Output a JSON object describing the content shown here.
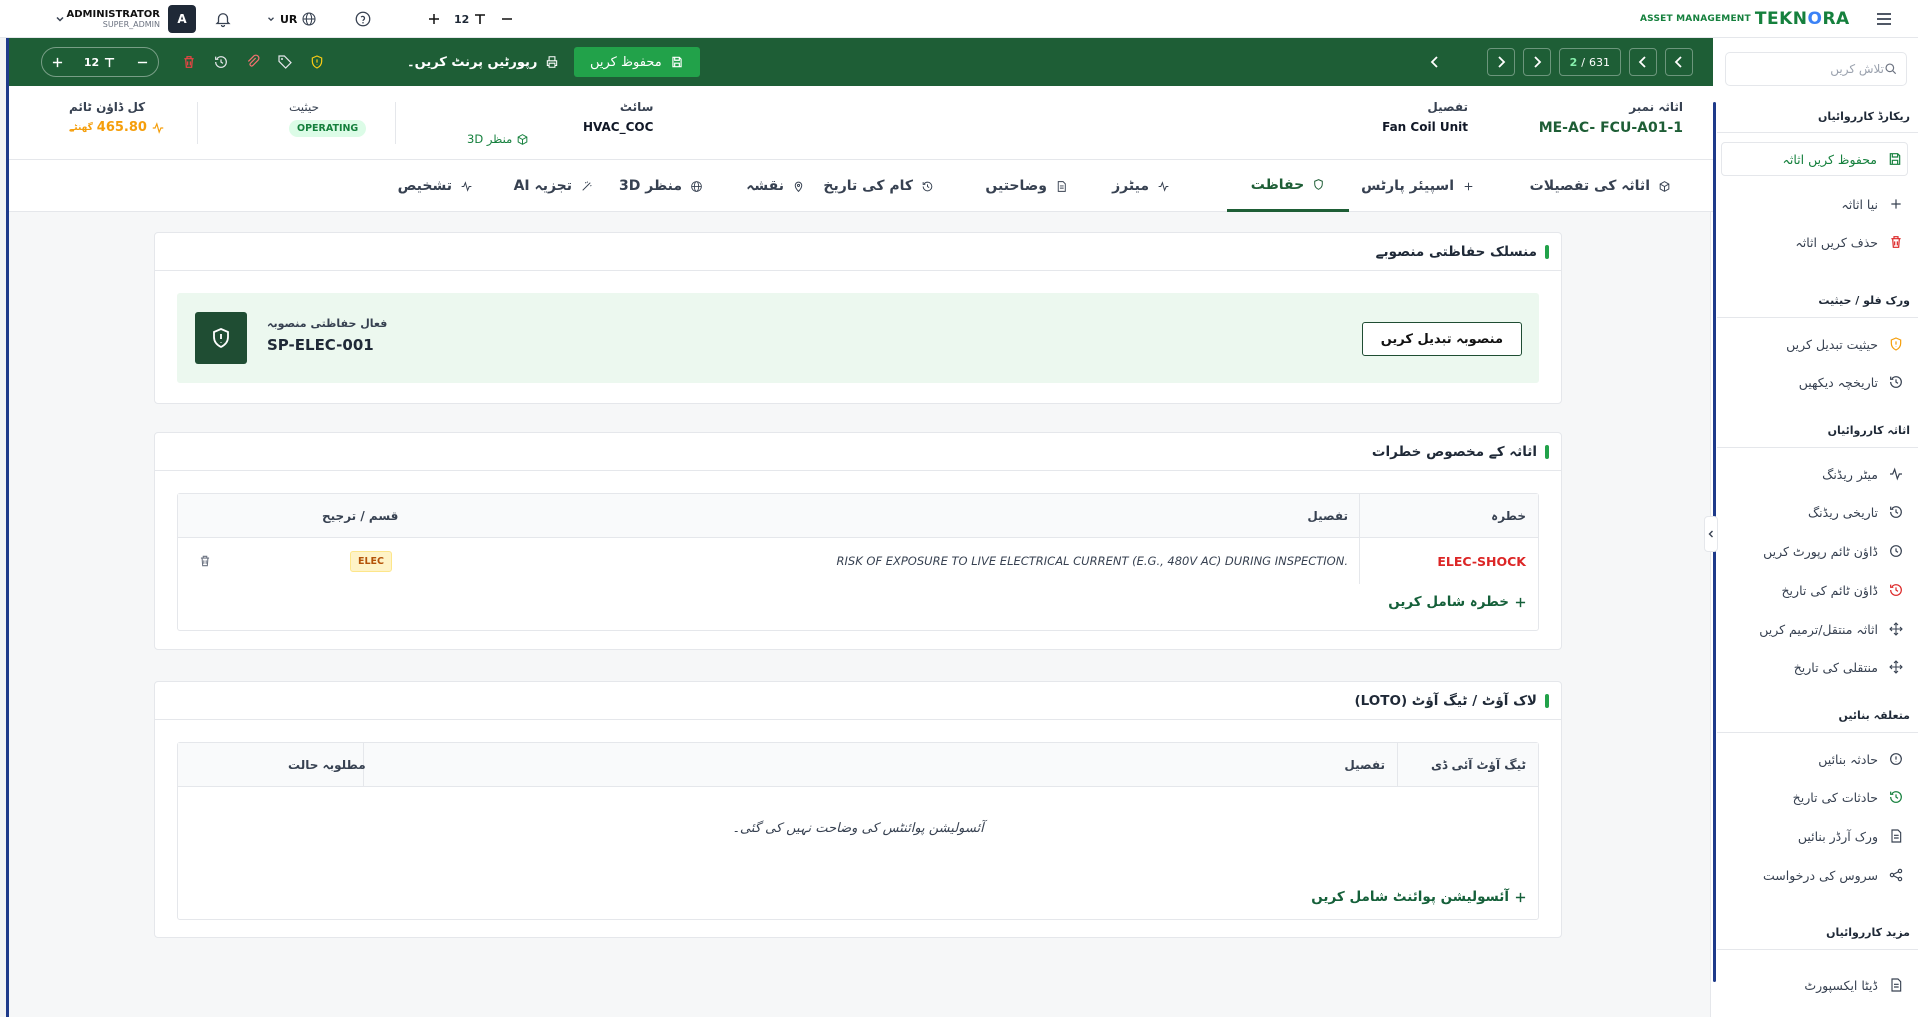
{
  "topbar": {
    "brand_sub": "ASSET MANAGEMENT",
    "brand_logo_a": "TEKN",
    "brand_logo_b": "O",
    "brand_logo_c": "RA",
    "user_name": "ADMINISTRATOR",
    "user_role": "SUPER_ADMIN",
    "avatar": "A",
    "lang": "UR",
    "font_size": "12"
  },
  "sidebar": {
    "search_placeholder": "تلاش کریں",
    "sections": {
      "record": "ریکارڈ کارروائیاں",
      "workflow": "ورک فلو / حیثیت",
      "asset": "اثاثہ کارروائیاں",
      "related": "متعلقہ بنائیں",
      "more": "مزید کارروائیاں"
    },
    "items": {
      "save": "محفوظ کریں اثاثہ",
      "new": "نیا اثاثہ",
      "delete": "حذف کریں اثاثہ",
      "change_status": "حیثیت تبدیل کریں",
      "history": "تاریخچہ دیکھیں",
      "meter_reading": "میٹر ریڈنگ",
      "historical_reading": "تاریخی ریڈنگ",
      "downtime_report": "ڈاؤن ٹائم رپورٹ کریں",
      "downtime_history": "ڈاؤن ٹائم کی تاریخ",
      "move_asset": "اثاثہ منتقل/ترمیم کریں",
      "move_history": "منتقلی کی تاریخ",
      "create_incident": "حادثہ بنائیں",
      "incident_history": "حادثات کی تاریخ",
      "create_work_order": "ورک آرڈر بنائیں",
      "service_request": "سروس کی درخواست",
      "data_export": "ڈیٹا ایکسپورٹ"
    }
  },
  "toolbar": {
    "page_current": "2",
    "page_sep": "/",
    "page_total": "631",
    "save": "محفوظ کریں",
    "print": "رپورٹیں پرنٹ کریں۔",
    "font_size": "12"
  },
  "info": {
    "asset_no_label": "اثاثہ نمبر",
    "asset_no": "ME-AC- FCU-A01-1",
    "desc_label": "تفصیل",
    "desc": "Fan Coil Unit",
    "site_label": "سائٹ",
    "site": "HVAC_COC",
    "view3d": "3D منظر",
    "status_label": "حیثیت",
    "status": "OPERATING",
    "downtime_label": "کل ڈاؤن ٹائم",
    "downtime": "465.80",
    "downtime_unit": "گھنٹے"
  },
  "tabs": {
    "details": "اثاثہ کی تفصیلات",
    "spare_parts": "اسپیئر پارٹس",
    "safety": "حفاظت",
    "meters": "میٹرز",
    "specs": "وضاحتیں",
    "work_history": "کام کی تاریخ",
    "map": "نقشہ",
    "view3d": "3D منظر",
    "ai": "AI تجزیہ",
    "diagnosis": "تشخیص"
  },
  "safety_plan": {
    "title": "منسلک حفاظتی منصوبے",
    "change_btn": "منصوبہ تبدیل کریں",
    "active_label": "فعال حفاظتی منصوبہ",
    "active_code": "SP-ELEC-001"
  },
  "hazards": {
    "title": "اثاثہ کے مخصوص خطرات",
    "columns": {
      "hazard": "خطرہ",
      "desc": "تفصیل",
      "type": "قسم / ترجیح"
    },
    "rows": [
      {
        "code": "ELEC-SHOCK",
        "desc": "RISK OF EXPOSURE TO LIVE ELECTRICAL CURRENT (E.G., 480V AC) DURING INSPECTION.",
        "type": "ELEC"
      }
    ],
    "add": "خطرہ شامل کریں"
  },
  "loto": {
    "title": "لاک آؤٹ / ٹیگ آؤٹ (LOTO)",
    "columns": {
      "tag_id": "ٹیگ آؤٹ آئی ڈی",
      "desc": "تفصیل",
      "required_state": "مطلوبہ حالت"
    },
    "empty": "آئسولیشن پوائنٹس کی وضاحت نہیں کی گئی۔",
    "add": "آئسولیشن پوائنٹ شامل کریں"
  }
}
